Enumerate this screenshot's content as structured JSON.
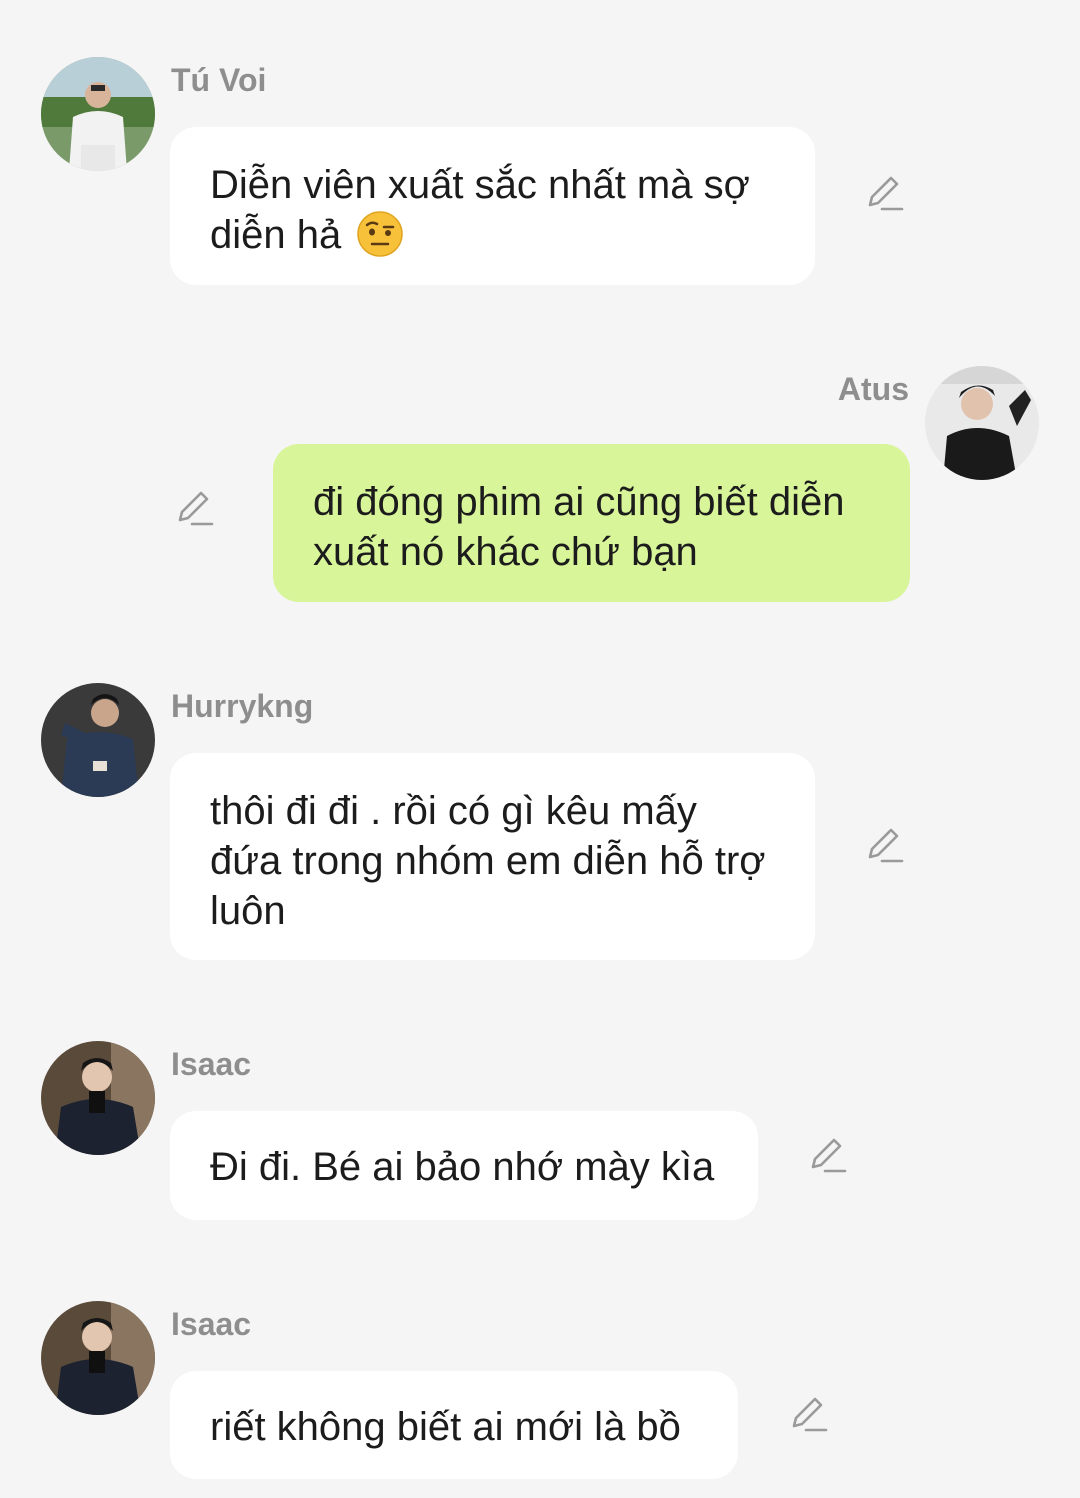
{
  "messages": [
    {
      "sender": "Tú Voi",
      "text": "Diễn viên xuất sắc nhất mà sợ diễn hả",
      "emoji": "raised-eyebrow-emoji",
      "avatar_icon": "avatar-tu-voi",
      "mine": false
    },
    {
      "sender": "Atus",
      "text": "đi đóng phim ai cũng biết diễn xuất nó khác chứ bạn",
      "avatar_icon": "avatar-atus",
      "mine": true
    },
    {
      "sender": "Hurrykng",
      "text": "thôi đi đi . rồi có gì kêu mấy đứa trong nhóm em diễn hỗ trợ luôn",
      "avatar_icon": "avatar-hurrykng",
      "mine": false
    },
    {
      "sender": "Isaac",
      "text": "Đi đi. Bé ai bảo nhớ mày kìa",
      "avatar_icon": "avatar-isaac",
      "mine": false
    },
    {
      "sender": "Isaac",
      "text": "riết không biết ai mới là bồ",
      "avatar_icon": "avatar-isaac",
      "mine": false
    }
  ],
  "icons": {
    "edit": "pencil-edit-icon"
  },
  "colors": {
    "background": "#f5f5f5",
    "incoming_bubble": "#ffffff",
    "outgoing_bubble": "#d8f59a",
    "sender_name": "#8e8e8e",
    "text": "#1c1c1c"
  }
}
